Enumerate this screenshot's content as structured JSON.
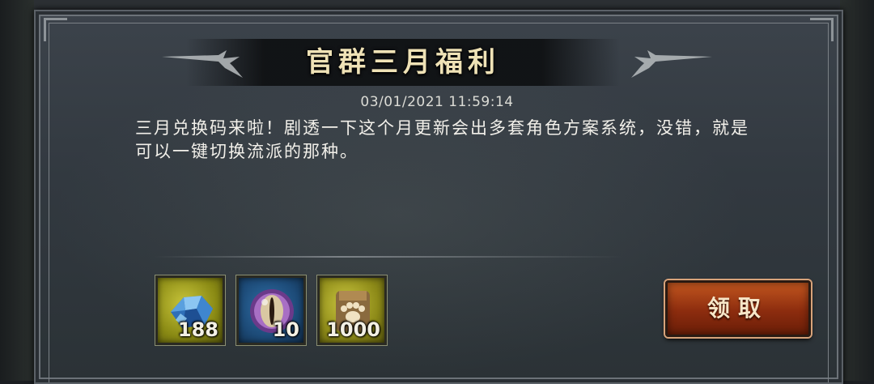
{
  "announcement": {
    "title": "官群三月福利",
    "timestamp": "03/01/2021 11:59:14",
    "body": "三月兑换码来啦！剧透一下这个月更新会出多套角色方案系统，没错，就是可以一键切换流派的那种。"
  },
  "rewards": [
    {
      "icon": "blue-gem-icon",
      "quantity": "188"
    },
    {
      "icon": "purple-eye-orb-icon",
      "quantity": "10"
    },
    {
      "icon": "paw-pouch-icon",
      "quantity": "1000"
    }
  ],
  "claim_button": {
    "label": "领取"
  },
  "colors": {
    "title": "#efe2b6",
    "claim_button": "#b04a1a",
    "panel": "#353c43"
  }
}
